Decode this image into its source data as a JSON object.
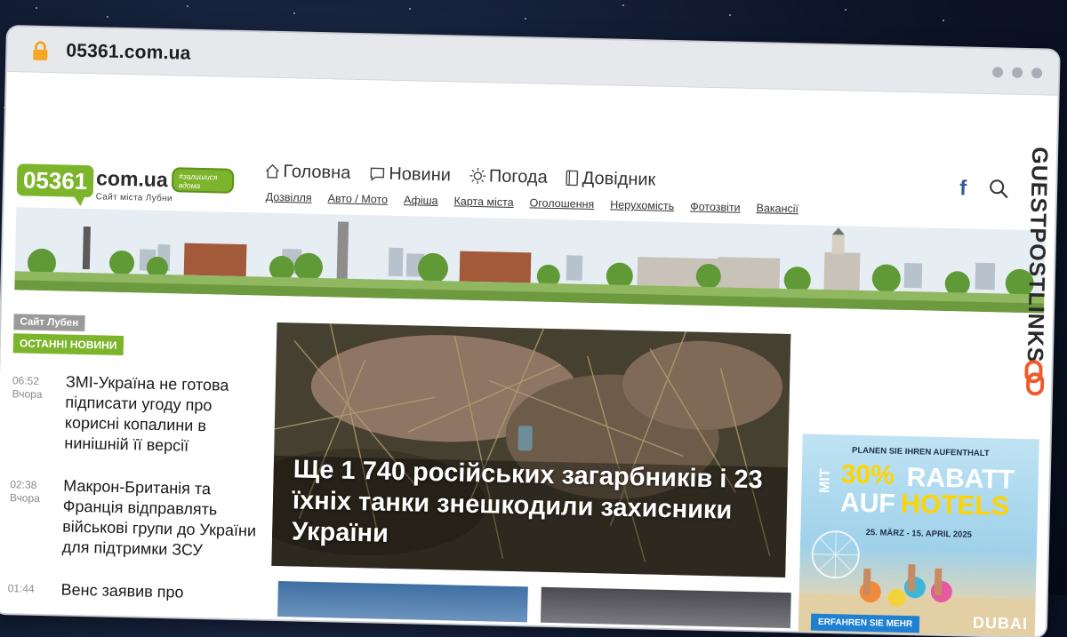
{
  "browser": {
    "url": "05361.com.ua"
  },
  "logo": {
    "number": "05361",
    "domain": "com.ua",
    "subtitle": "Сайт міста Лубни",
    "badge_line1": "#залишися",
    "badge_line2": "вдома"
  },
  "nav": {
    "main": [
      {
        "label": "Головна",
        "icon": "home-icon"
      },
      {
        "label": "Новини",
        "icon": "chat-icon"
      },
      {
        "label": "Погода",
        "icon": "sun-icon"
      },
      {
        "label": "Довідник",
        "icon": "book-icon"
      }
    ],
    "sub": [
      "Дозвілля",
      "Авто / Мото",
      "Афіша",
      "Карта міста",
      "Оголошення",
      "Нерухомість",
      "Фотозвіти",
      "Вакансії"
    ]
  },
  "header": {
    "facebook": "f"
  },
  "watermark": {
    "text": "GUESTPOSTLINKS"
  },
  "sidebar": {
    "site_tag": "Сайт Лубен",
    "section_title": "ОСТАННІ НОВИНИ",
    "news": [
      {
        "time": "06:52",
        "day": "Вчора",
        "title": "ЗМІ-Україна не готова підписати угоду про корисні копалини в нинішній її версії"
      },
      {
        "time": "02:38",
        "day": "Вчора",
        "title": "Макрон-Британія та Франція відправлять військові групи до України для підтримки ЗСУ"
      },
      {
        "time": "01:44",
        "day": "",
        "title": "Венс заявив про"
      }
    ]
  },
  "hero": {
    "title": "Ще 1 740 російських загарбників і 23 їхніх танки знешкодили захисники України"
  },
  "ad": {
    "top": "PLANEN SIE IHREN AUFENTHALT",
    "mit": "MIT",
    "percent": "30%",
    "rabatt": "RABATT",
    "auf": "AUF",
    "hotels": "HOTELS",
    "dates": "25. MÄRZ - 15. APRIL 2025",
    "button": "ERFAHREN SIE MEHR",
    "brand": "DUBAI"
  },
  "colors": {
    "brand_green": "#7cb42b",
    "facebook_blue": "#3b5998",
    "gpl_orange": "#ef5a2a"
  }
}
